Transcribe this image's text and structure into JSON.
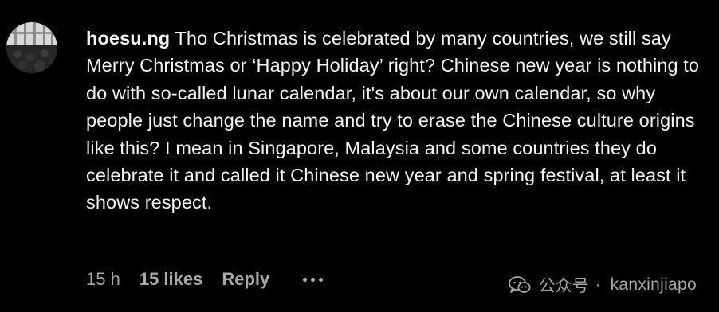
{
  "comment": {
    "username": "hoesu.ng",
    "text": "Tho Christmas is celebrated by many countries, we still say Merry Christmas or ‘Happy Holiday’ right? Chinese new year is nothing to do with so-called lunar calendar, it's about our own calendar, so why people just change the name and try to erase the Chinese culture origins like this? I mean in Singapore, Malaysia and some countries they do celebrate it and called it Chinese new year and spring festival, at least it shows respect."
  },
  "meta": {
    "time": "15 h",
    "likes": "15 likes",
    "reply_label": "Reply",
    "more_icon": "ellipsis-icon"
  },
  "watermark": {
    "platform": "公众号",
    "separator": "·",
    "account": "kanxinjiapo",
    "icon": "wechat-icon"
  },
  "colors": {
    "background": "#000000",
    "text": "#f5f5f5",
    "muted": "#a8a8a8"
  }
}
